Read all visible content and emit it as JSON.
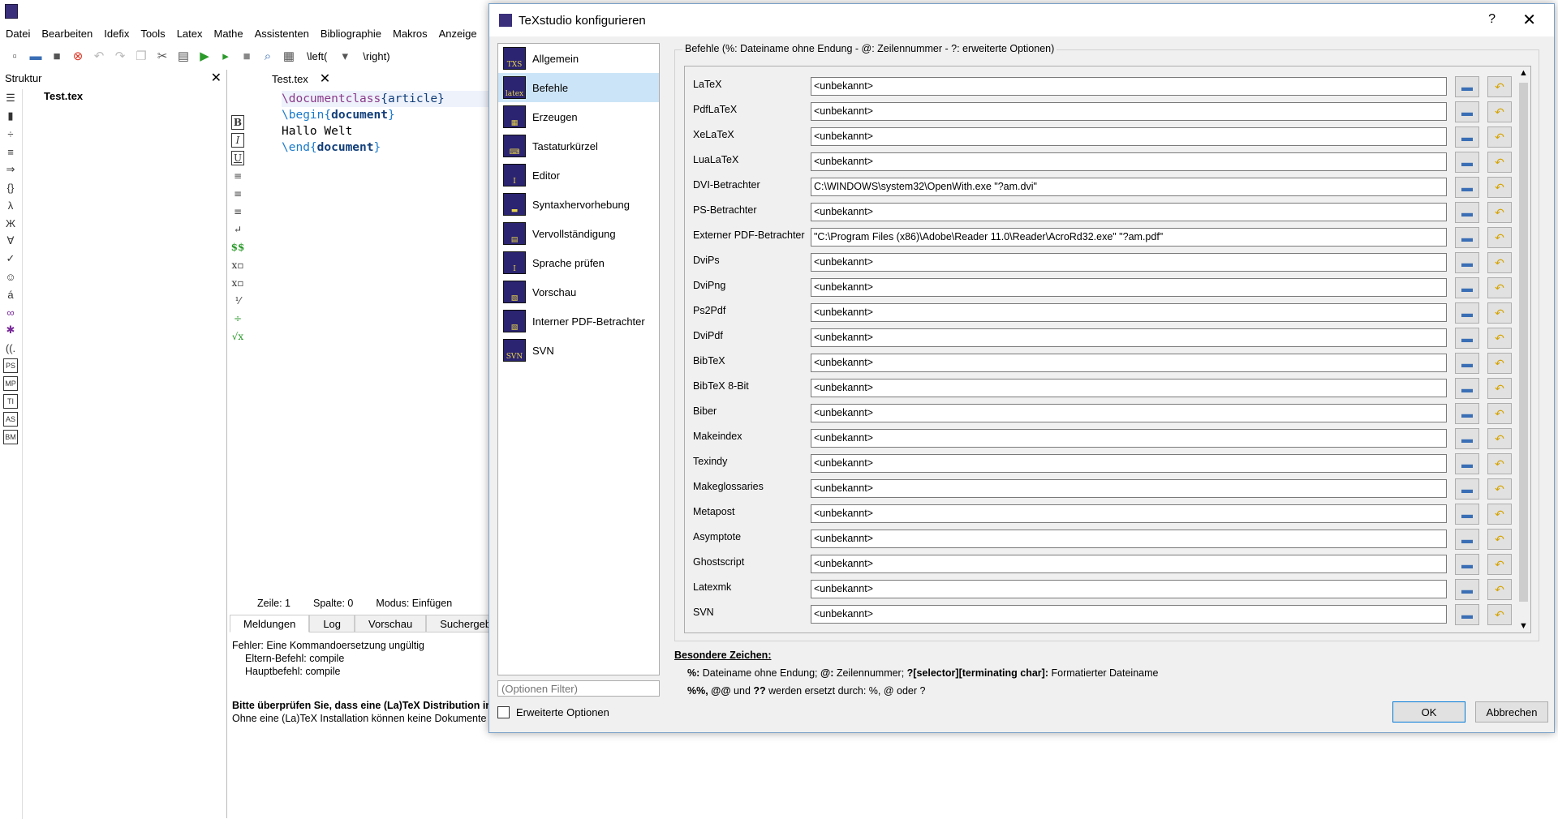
{
  "app": {
    "menu": [
      "Datei",
      "Bearbeiten",
      "Idefix",
      "Tools",
      "Latex",
      "Mathe",
      "Assistenten",
      "Bibliographie",
      "Makros",
      "Anzeige"
    ],
    "toolbar": {
      "left_label": "\\left(",
      "right_label": "\\right)"
    }
  },
  "structure": {
    "title": "Struktur",
    "file": "Test.tex"
  },
  "editor": {
    "tab": "Test.tex",
    "code": [
      "\\documentclass{article}",
      "\\begin{document}",
      "Hallo Welt",
      "\\end{document}"
    ],
    "status": {
      "line": "Zeile: 1",
      "column": "Spalte: 0",
      "mode": "Modus: Einfügen"
    }
  },
  "log": {
    "tabs": [
      "Meldungen",
      "Log",
      "Vorschau",
      "Suchergebnisse"
    ],
    "lines": [
      "Fehler: Eine Kommandoersetzung ungültig",
      "Eltern-Befehl: compile",
      "Hauptbefehl: compile",
      "Bitte überprüfen Sie, dass eine (La)TeX Distribution installiert ist",
      "Ohne eine (La)TeX Installation können keine Dokumente kompiliert werden"
    ]
  },
  "dialog": {
    "title": "TeXstudio konfigurieren",
    "help": "?",
    "categories": [
      "Allgemein",
      "Befehle",
      "Erzeugen",
      "Tastaturkürzel",
      "Editor",
      "Syntaxhervorhebung",
      "Vervollständigung",
      "Sprache prüfen",
      "Vorschau",
      "Interner PDF-Betrachter",
      "SVN"
    ],
    "selected_category": "Befehle",
    "filter_placeholder": "(Optionen Filter)",
    "advanced_options": "Erweiterte Optionen",
    "group_title": "Befehle (%: Dateiname ohne Endung - @: Zeilennummer - ?: erweiterte Optionen)",
    "commands": [
      {
        "label": "LaTeX",
        "value": "<unbekannt>"
      },
      {
        "label": "PdfLaTeX",
        "value": "<unbekannt>"
      },
      {
        "label": "XeLaTeX",
        "value": "<unbekannt>"
      },
      {
        "label": "LuaLaTeX",
        "value": "<unbekannt>"
      },
      {
        "label": "DVI-Betrachter",
        "value": "C:\\WINDOWS\\system32\\OpenWith.exe \"?am.dvi\""
      },
      {
        "label": "PS-Betrachter",
        "value": "<unbekannt>"
      },
      {
        "label": "Externer PDF-Betrachter",
        "value": "\"C:\\Program Files (x86)\\Adobe\\Reader 11.0\\Reader\\AcroRd32.exe\" \"?am.pdf\""
      },
      {
        "label": "DviPs",
        "value": "<unbekannt>"
      },
      {
        "label": "DviPng",
        "value": "<unbekannt>"
      },
      {
        "label": "Ps2Pdf",
        "value": "<unbekannt>"
      },
      {
        "label": "DviPdf",
        "value": "<unbekannt>"
      },
      {
        "label": "BibTeX",
        "value": "<unbekannt>"
      },
      {
        "label": "BibTeX 8-Bit",
        "value": "<unbekannt>"
      },
      {
        "label": "Biber",
        "value": "<unbekannt>"
      },
      {
        "label": "Makeindex",
        "value": "<unbekannt>"
      },
      {
        "label": "Texindy",
        "value": "<unbekannt>"
      },
      {
        "label": "Makeglossaries",
        "value": "<unbekannt>"
      },
      {
        "label": "Metapost",
        "value": "<unbekannt>"
      },
      {
        "label": "Asymptote",
        "value": "<unbekannt>"
      },
      {
        "label": "Ghostscript",
        "value": "<unbekannt>"
      },
      {
        "label": "Latexmk",
        "value": "<unbekannt>"
      },
      {
        "label": "SVN",
        "value": "<unbekannt>"
      }
    ],
    "special": {
      "heading": "Besondere Zeichen:",
      "line1_key1": "%:",
      "line1_text1": " Dateiname ohne Endung; ",
      "line1_key2": "@:",
      "line1_text2": " Zeilennummer; ",
      "line1_key3": "?[selector][terminating char]:",
      "line1_text3": " Formatierter Dateiname",
      "line2_key1": "%%, @@",
      "line2_text1": " und ",
      "line2_key2": "??",
      "line2_text2": " werden ersetzt durch: %, @ oder ?"
    },
    "ok": "OK",
    "cancel": "Abbrechen"
  },
  "colors": {
    "selection": "#cce4f7",
    "accent": "#0078d7"
  }
}
